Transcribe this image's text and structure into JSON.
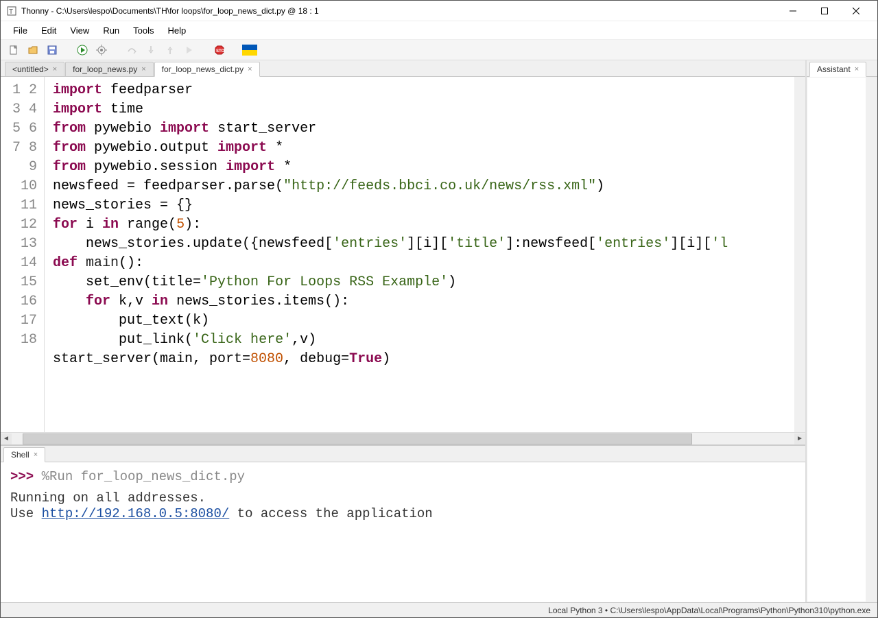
{
  "window": {
    "title": "Thonny  -  C:\\Users\\lespo\\Documents\\TH\\for loops\\for_loop_news_dict.py  @  18 : 1"
  },
  "menu": [
    "File",
    "Edit",
    "View",
    "Run",
    "Tools",
    "Help"
  ],
  "tabs": [
    {
      "label": "<untitled>",
      "closable": true,
      "active": false
    },
    {
      "label": "for_loop_news.py",
      "closable": true,
      "active": false
    },
    {
      "label": "for_loop_news_dict.py",
      "closable": true,
      "active": true
    }
  ],
  "right_panel": {
    "label": "Assistant"
  },
  "shell_tab": {
    "label": "Shell"
  },
  "status": "Local Python 3  •  C:\\Users\\lespo\\AppData\\Local\\Programs\\Python\\Python310\\python.exe",
  "code": {
    "lines": 18,
    "tokens": [
      [
        [
          "kw",
          "import"
        ],
        [
          "",
          " feedparser"
        ]
      ],
      [
        [
          "kw",
          "import"
        ],
        [
          "",
          " time"
        ]
      ],
      [
        [
          "kw",
          "from"
        ],
        [
          "",
          " pywebio "
        ],
        [
          "kw",
          "import"
        ],
        [
          "",
          " start_server"
        ]
      ],
      [
        [
          "kw",
          "from"
        ],
        [
          "",
          " pywebio.output "
        ],
        [
          "kw",
          "import"
        ],
        [
          "",
          " *"
        ]
      ],
      [
        [
          "kw",
          "from"
        ],
        [
          "",
          " pywebio.session "
        ],
        [
          "kw",
          "import"
        ],
        [
          "",
          " *"
        ]
      ],
      [
        [
          "",
          "newsfeed = feedparser.parse("
        ],
        [
          "str",
          "\"http://feeds.bbci.co.uk/news/rss.xml\""
        ],
        [
          "",
          ")"
        ]
      ],
      [
        [
          "",
          "news_stories = {}"
        ]
      ],
      [
        [
          "kw",
          "for"
        ],
        [
          "",
          " i "
        ],
        [
          "kw",
          "in"
        ],
        [
          "",
          " range("
        ],
        [
          "num",
          "5"
        ],
        [
          "",
          "):"
        ]
      ],
      [
        [
          "",
          "    news_stories.update({newsfeed["
        ],
        [
          "str",
          "'entries'"
        ],
        [
          "",
          "][i]["
        ],
        [
          "str",
          "'title'"
        ],
        [
          "",
          "]:newsfeed["
        ],
        [
          "str",
          "'entries'"
        ],
        [
          "",
          "][i]["
        ],
        [
          "str",
          "'l"
        ]
      ],
      [
        [
          "",
          ""
        ]
      ],
      [
        [
          "kw",
          "def"
        ],
        [
          "",
          " "
        ],
        [
          "fn",
          "main"
        ],
        [
          "",
          "():"
        ]
      ],
      [
        [
          "",
          "    set_env(title="
        ],
        [
          "str",
          "'Python For Loops RSS Example'"
        ],
        [
          "",
          ")"
        ]
      ],
      [
        [
          "",
          "    "
        ],
        [
          "kw",
          "for"
        ],
        [
          "",
          " k,v "
        ],
        [
          "kw",
          "in"
        ],
        [
          "",
          " news_stories.items():"
        ]
      ],
      [
        [
          "",
          "        put_text(k)"
        ]
      ],
      [
        [
          "",
          "        put_link("
        ],
        [
          "str",
          "'Click here'"
        ],
        [
          "",
          ",v)"
        ]
      ],
      [
        [
          "",
          ""
        ]
      ],
      [
        [
          "",
          "start_server(main, port="
        ],
        [
          "num",
          "8080"
        ],
        [
          "",
          ", debug="
        ],
        [
          "true",
          "True"
        ],
        [
          "",
          ")"
        ]
      ],
      [
        [
          "",
          ""
        ]
      ]
    ]
  },
  "shell": {
    "prompt": ">>> ",
    "cmd": "%Run for_loop_news_dict.py",
    "out1": " Running on all addresses.",
    "out2a": " Use ",
    "link": "http://192.168.0.5:8080/",
    "out2b": " to access the application"
  }
}
